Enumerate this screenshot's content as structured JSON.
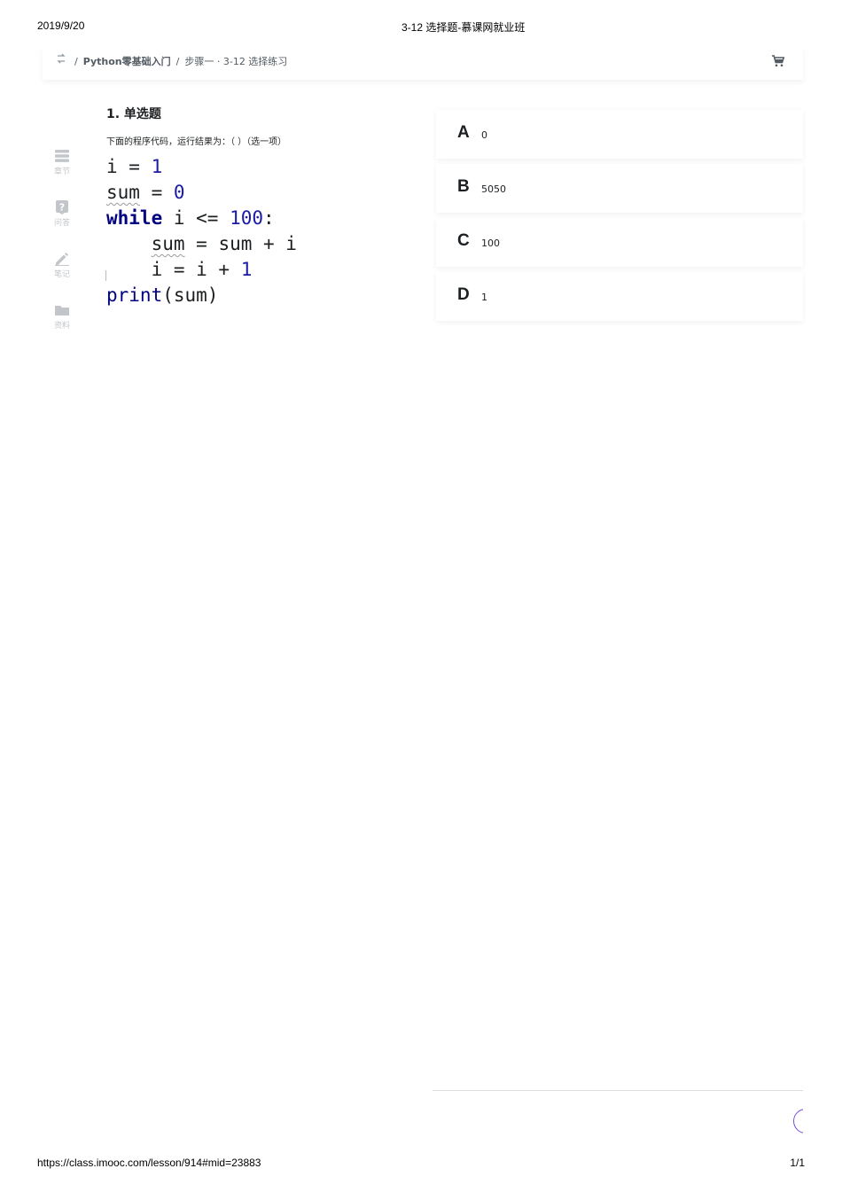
{
  "print_header": {
    "date": "2019/9/20",
    "title": "3-12 选择题-慕课网就业班"
  },
  "print_footer": {
    "url": "https://class.imooc.com/lesson/914#mid=23883",
    "page": "1/1"
  },
  "topbar": {
    "back_icon": "switch-arrows-icon",
    "breadcrumb": {
      "sep1": "/",
      "course": "Python零基础入门",
      "sep2": "/",
      "current": "步骤一 · 3-12 选择练习"
    },
    "cart_icon": "shopping-cart-icon"
  },
  "sidebar": {
    "items": [
      {
        "label": "章节",
        "icon": "chapters-icon"
      },
      {
        "label": "问答",
        "icon": "question-icon"
      },
      {
        "label": "笔记",
        "icon": "pencil-icon"
      },
      {
        "label": "资料",
        "icon": "folder-icon"
      }
    ],
    "color": "#c2c6ca"
  },
  "question": {
    "title": "1. 单选题",
    "text": "下面的程序代码，运行结果为：（ ）（选一项）",
    "code": {
      "l1": {
        "a": "i = ",
        "b": "1"
      },
      "l2": {
        "a": "sum",
        "b": " = ",
        "c": "0"
      },
      "l3": {
        "a": "while",
        "b": " i <= ",
        "c": "100",
        "d": ":"
      },
      "l4": {
        "a": "    ",
        "b": "sum",
        "c": " = sum + i"
      },
      "l5": {
        "a": "    i = i + ",
        "b": "1"
      },
      "l6": {
        "a": "print",
        "b": "(sum)"
      }
    }
  },
  "options": [
    {
      "letter": "A",
      "text": "0"
    },
    {
      "letter": "B",
      "text": "5050"
    },
    {
      "letter": "C",
      "text": "100"
    },
    {
      "letter": "D",
      "text": "1"
    }
  ],
  "colors": {
    "accent": "#7b4cd8",
    "text": "#1c1f21",
    "code_number": "#1a1aa6",
    "code_keyword": "#000080"
  }
}
